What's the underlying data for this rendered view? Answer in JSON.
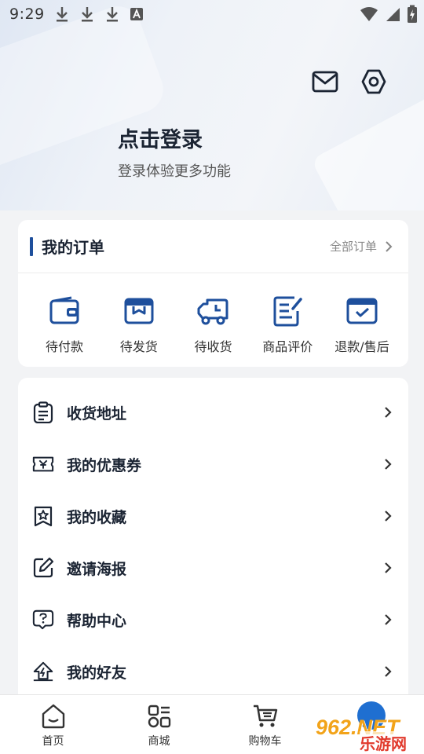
{
  "status_bar": {
    "time": "9:29",
    "left_icons": [
      "download-icon",
      "download-icon",
      "download-icon",
      "font-a-icon"
    ],
    "right_icons": [
      "wifi-icon",
      "signal-icon",
      "battery-charging-icon"
    ]
  },
  "header": {
    "login_title": "点击登录",
    "login_subtitle": "登录体验更多功能",
    "actions": [
      "mail-icon",
      "settings-icon"
    ]
  },
  "orders": {
    "title": "我的订单",
    "all_orders_label": "全部订单",
    "items": [
      {
        "label": "待付款",
        "icon": "wallet-icon"
      },
      {
        "label": "待发货",
        "icon": "package-icon"
      },
      {
        "label": "待收货",
        "icon": "truck-icon"
      },
      {
        "label": "商品评价",
        "icon": "review-icon"
      },
      {
        "label": "退款/售后",
        "icon": "refund-icon"
      }
    ]
  },
  "menu": {
    "items": [
      {
        "label": "收货地址",
        "icon": "address-icon"
      },
      {
        "label": "我的优惠券",
        "icon": "coupon-icon"
      },
      {
        "label": "我的收藏",
        "icon": "favorite-icon"
      },
      {
        "label": "邀请海报",
        "icon": "poster-edit-icon"
      },
      {
        "label": "帮助中心",
        "icon": "help-icon"
      },
      {
        "label": "我的好友",
        "icon": "friends-icon"
      }
    ]
  },
  "tabbar": {
    "tabs": [
      {
        "label": "首页",
        "icon": "home-icon"
      },
      {
        "label": "商城",
        "icon": "grid-icon"
      },
      {
        "label": "购物车",
        "icon": "cart-icon"
      }
    ]
  },
  "watermark": {
    "logo_text": "962.NET",
    "sub_text": "乐游网"
  },
  "colors": {
    "accent": "#1e4f9c",
    "text_dark": "#1b2433"
  }
}
